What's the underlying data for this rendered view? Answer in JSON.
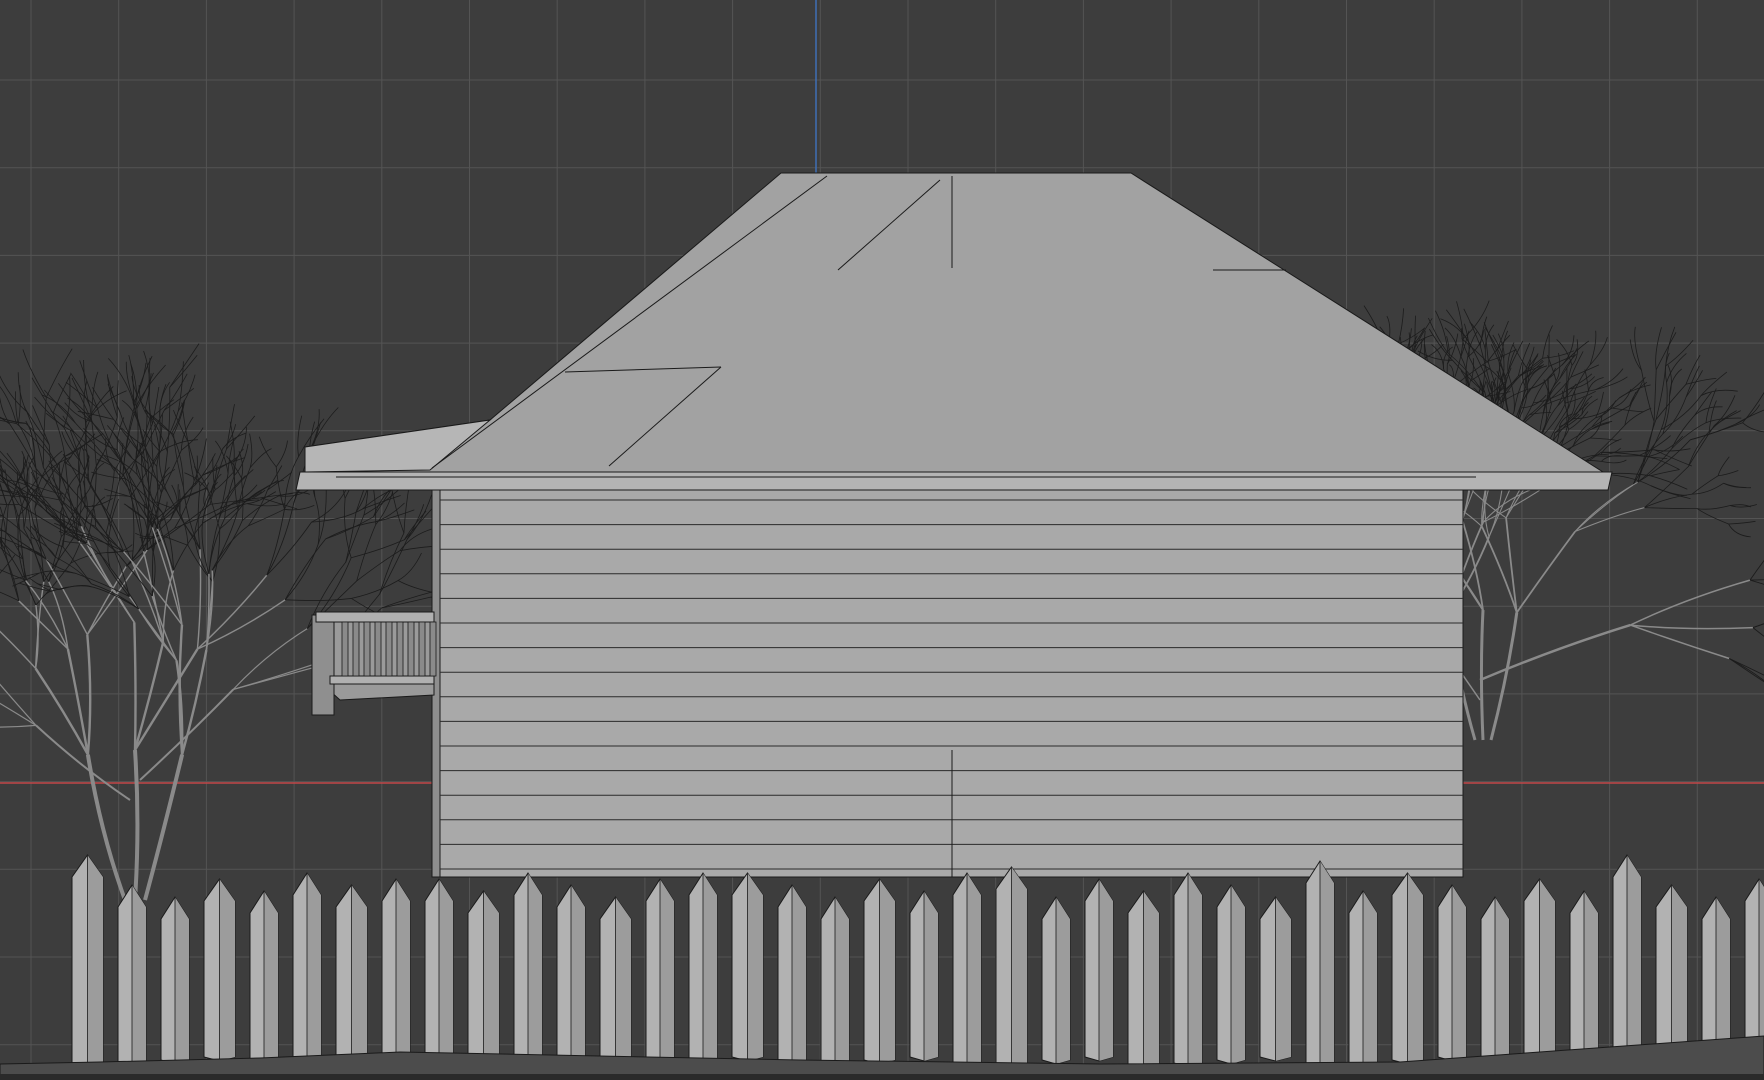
{
  "viewport": {
    "background": "#3d3d3d",
    "grid_color": "#545454",
    "x_axis_color": "#c24648",
    "z_axis_color": "#3f6fb5",
    "mesh_color": "#a9a9a9",
    "wire_color": "#1a1a1a",
    "view": "side-orthographic",
    "shading": "solid"
  },
  "scene": {
    "objects": [
      "house-walls",
      "hip-roof",
      "porch-railing",
      "bare-tree-left",
      "bare-tree-right",
      "picket-fence",
      "ground"
    ]
  }
}
